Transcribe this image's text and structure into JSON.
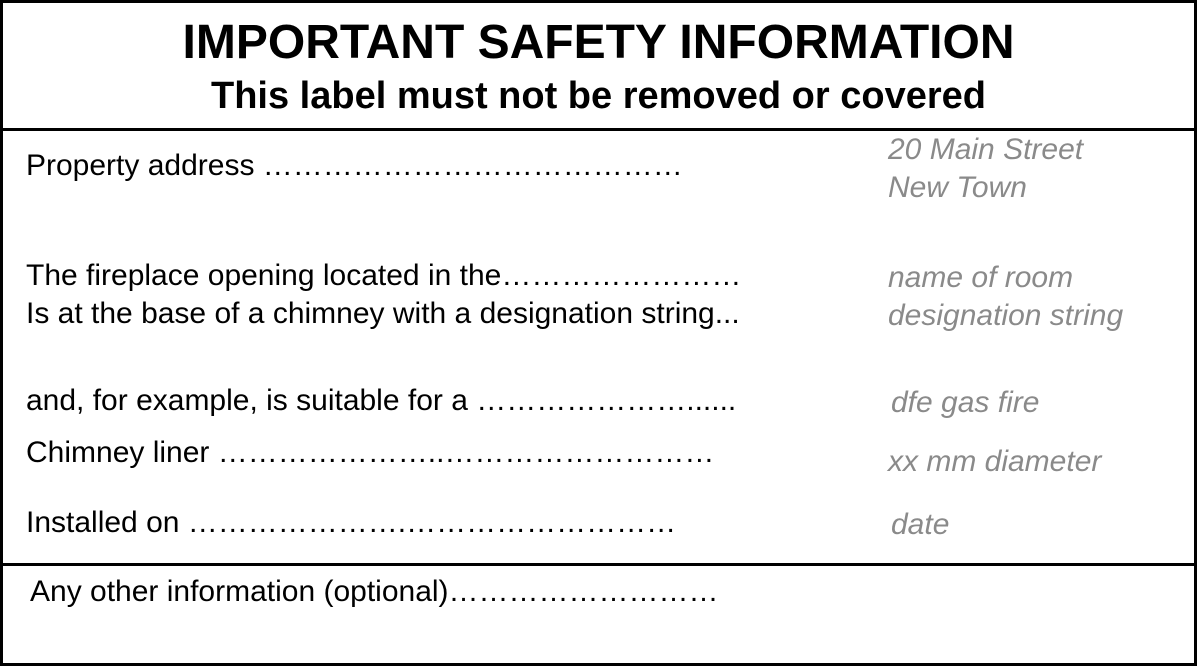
{
  "header": {
    "title": "IMPORTANT SAFETY INFORMATION",
    "subtitle": "This label must not be removed or covered"
  },
  "fields": {
    "address_label": "Property address ……………………………………",
    "address_line1": "20 Main Street",
    "address_line2": "New Town",
    "room_label": "The fireplace opening located in the……………………",
    "room_value": "name of room",
    "designation_label": "Is at the base of a chimney with a designation string...",
    "designation_value": "designation string",
    "suitable_label": "and, for example, is suitable for a …………………......",
    "suitable_value": "dfe gas fire",
    "liner_label": "Chimney liner …………………..………………………",
    "liner_value": "xx mm diameter",
    "installed_label": "Installed on  ………………….………………………",
    "installed_value": "date"
  },
  "footer": {
    "other_label": "Any other information (optional)………………………"
  }
}
